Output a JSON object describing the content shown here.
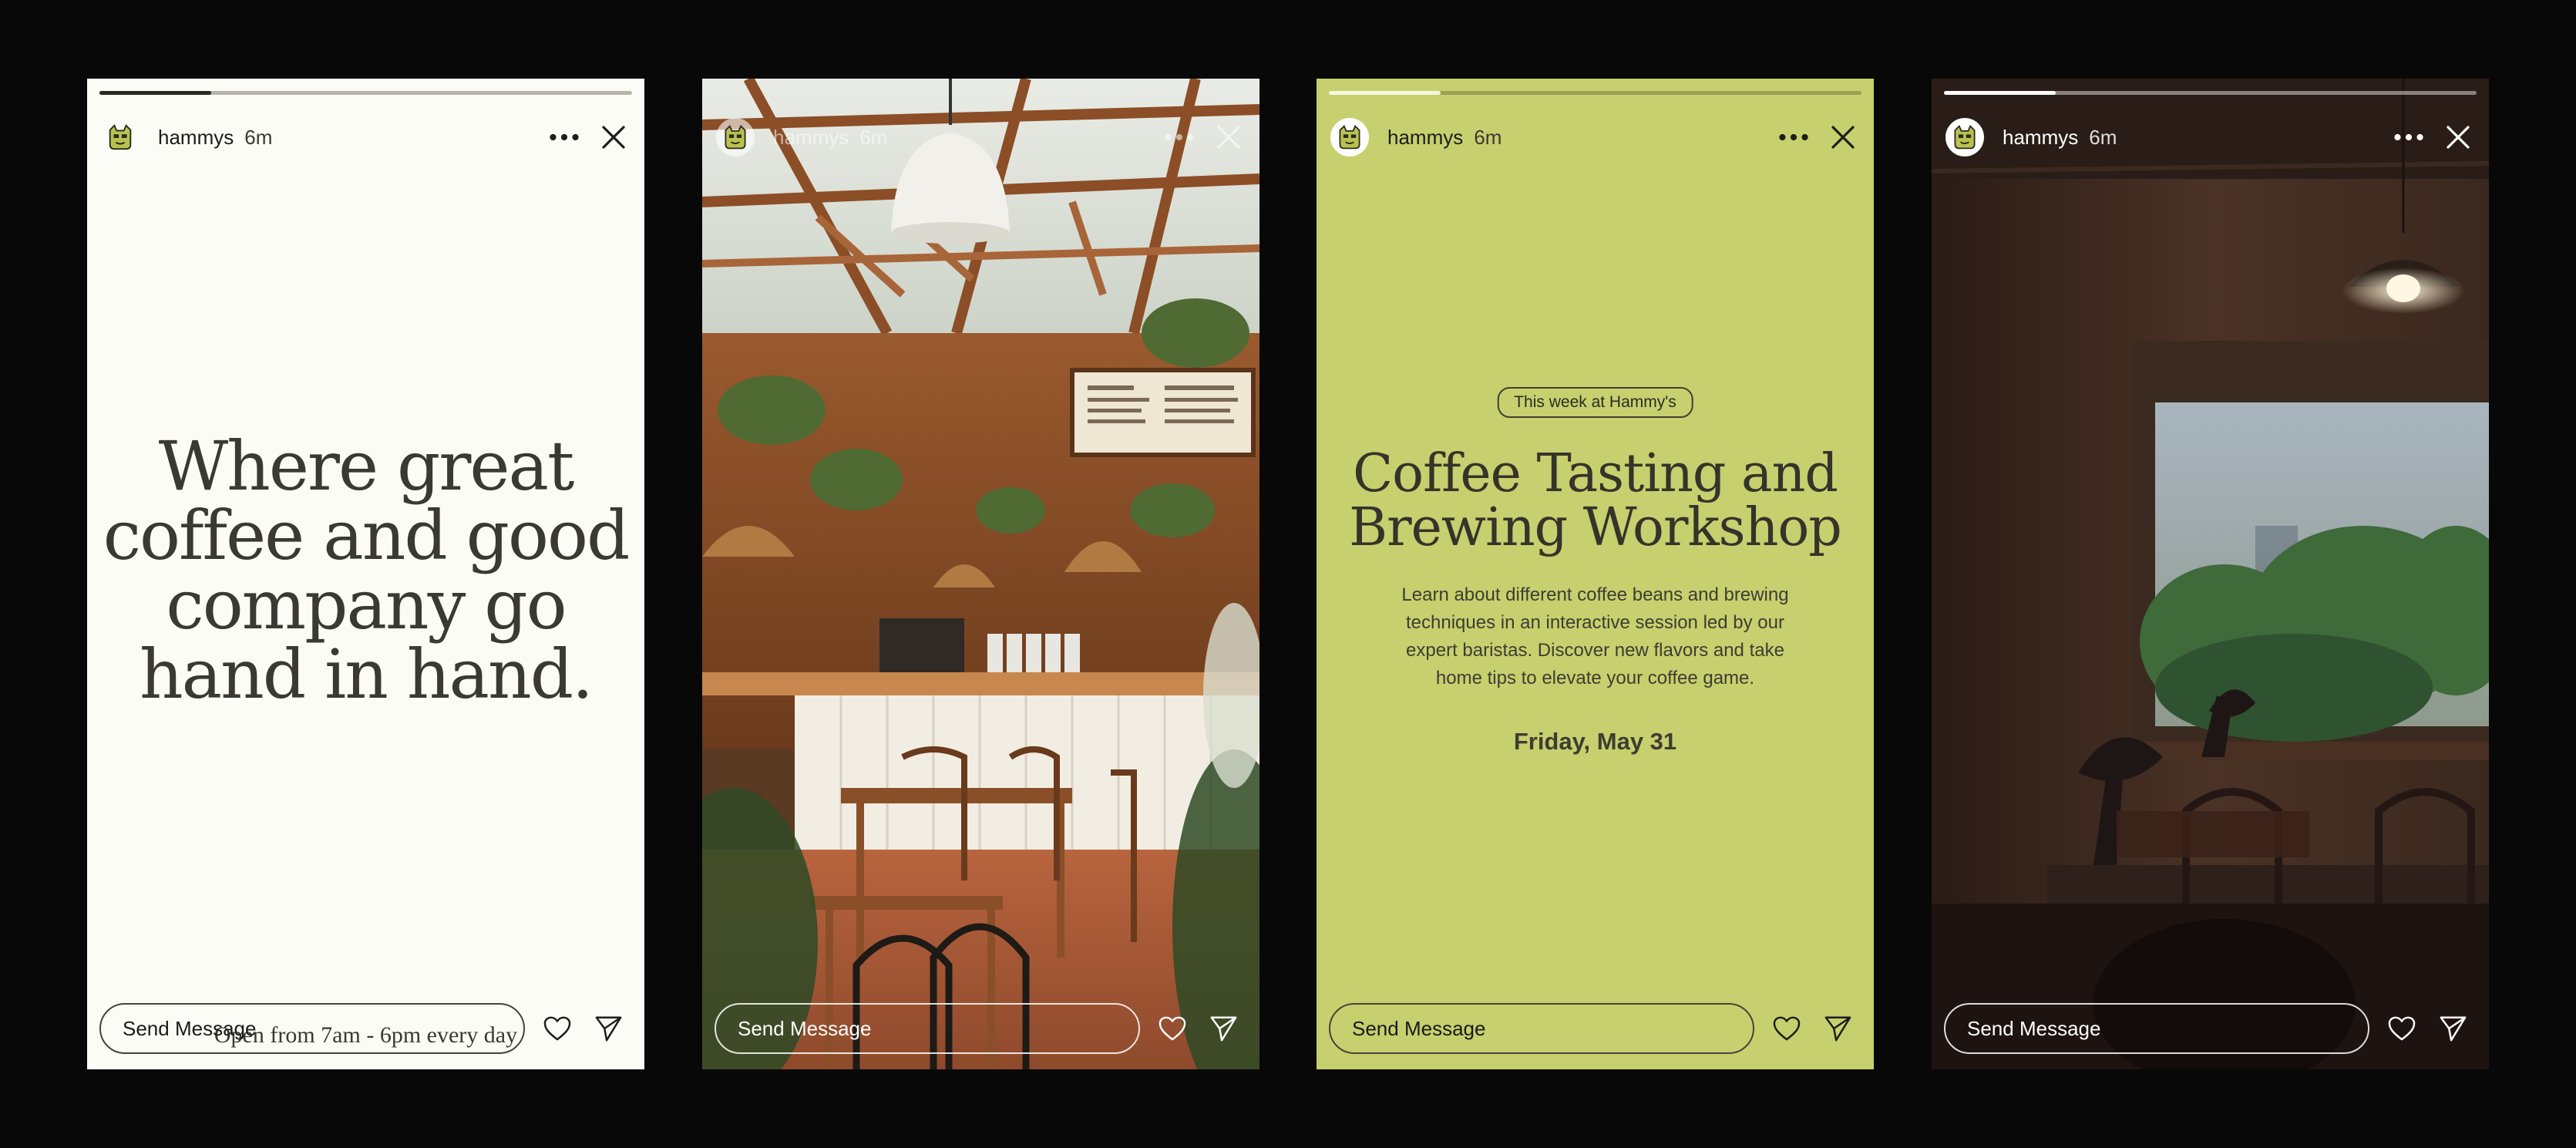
{
  "stories": [
    {
      "username": "hammys",
      "time": "6m",
      "progress": 0.21,
      "headline": [
        "Where great",
        "coffee and good",
        "company go",
        "hand in hand."
      ],
      "subtext": "Open from 7am - 6pm every day",
      "message_placeholder": "Send Message"
    },
    {
      "username": "hammys",
      "time": "6m",
      "message_placeholder": "Send Message"
    },
    {
      "username": "hammys",
      "time": "6m",
      "progress": 0.21,
      "badge": "This week at Hammy's",
      "headline": [
        "Coffee Tasting and",
        "Brewing Workshop"
      ],
      "description": "Learn about different coffee beans and brewing techniques in an interactive session led by our expert baristas. Discover new flavors and take home tips to elevate your coffee game.",
      "date": "Friday, May 31",
      "message_placeholder": "Send Message"
    },
    {
      "username": "hammys",
      "time": "6m",
      "progress": 0.21,
      "message_placeholder": "Send Message"
    }
  ],
  "colors": {
    "page_background": "#080808",
    "story1_background": "#fcfcf6",
    "story3_background": "#c6d06e",
    "avatar_mascot": "#b8c24e"
  },
  "icons": [
    "mascot-avatar-icon",
    "more-dots-icon",
    "close-icon",
    "heart-icon",
    "send-icon"
  ]
}
